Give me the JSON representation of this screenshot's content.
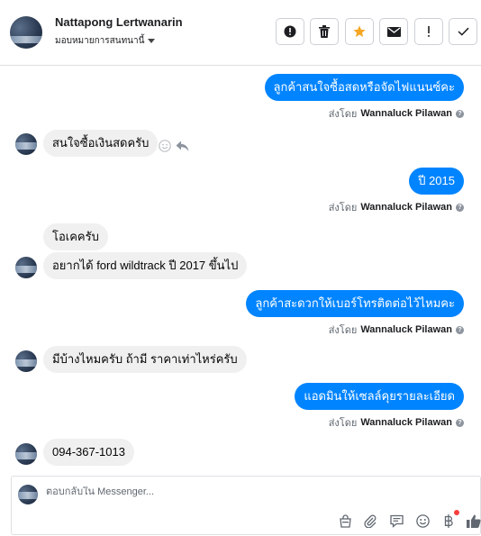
{
  "header": {
    "name": "Nattapong Lertwanarin",
    "subtitle": "มอบหมายการสนทนานี้"
  },
  "messages": {
    "m1": "ลูกค้าสนใจซื้อสดหรือจัดไฟแนนซ์คะ",
    "m2": "สนใจซื้อเงินสดครับ",
    "m3": "ปี 2015",
    "m4": "โอเคครับ",
    "m5": "อยากได้ ford wildtrack ปี 2017 ขึ้นไป",
    "m6": "ลูกค้าสะดวกให้เบอร์โทรติดต่อไว้ไหมคะ",
    "m7": "มีบ้างไหมครับ ถ้ามี ราคาเท่าไหร่ครับ",
    "m8": "แอดมินให้เซลล์คุยรายละเอียด",
    "m9": "094-367-1013"
  },
  "sent_by": {
    "prefix": "ส่งโดย",
    "agent": "Wannaluck Pilawan"
  },
  "composer": {
    "placeholder": "ตอบกลับใน Messenger..."
  },
  "colors": {
    "outgoing_bubble": "#0084ff",
    "incoming_bubble": "#f1f0f0",
    "star_accent": "#f5a623"
  },
  "icons": {
    "header_actions": [
      "alert-icon",
      "trash-icon",
      "star-icon",
      "mail-icon",
      "exclamation-icon",
      "check-icon"
    ],
    "composer_tools": [
      "shop-icon",
      "attach-icon",
      "saved-reply-icon",
      "emoji-icon",
      "baht-icon",
      "like-icon"
    ]
  }
}
